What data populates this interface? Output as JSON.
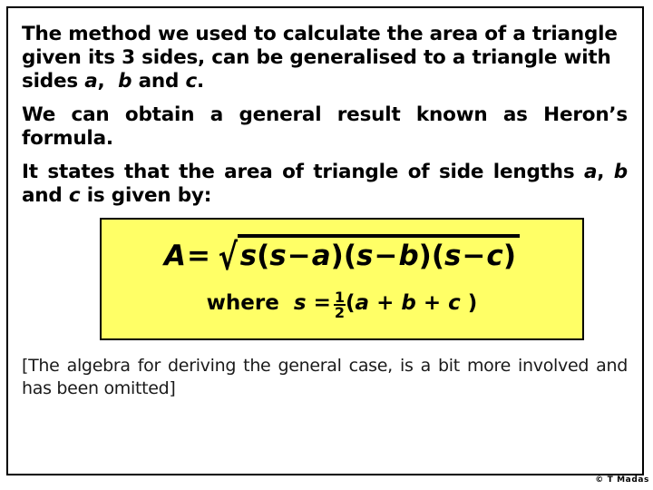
{
  "slide": {
    "paragraphs": [
      {
        "id": "intro",
        "segments": [
          {
            "text": "The method we used to calculate the area of a triangle given its 3 sides, can be generalised to a triangle with sides ",
            "style": "normal"
          },
          {
            "text": "a",
            "style": "italic"
          },
          {
            "text": ",  ",
            "style": "normal"
          },
          {
            "text": "b",
            "style": "italic"
          },
          {
            "text": " and ",
            "style": "normal"
          },
          {
            "text": "c",
            "style": "italic"
          },
          {
            "text": ".",
            "style": "normal"
          }
        ],
        "plain": "The method we used to calculate the area of a triangle given its 3 sides, can be generalised to a triangle with sides a,  b and c."
      },
      {
        "id": "heron",
        "plain": "We can obtain a general result known as Heron’s formula."
      },
      {
        "id": "states",
        "plain": "It states that the area of triangle of side lengths a, b and c is given by:"
      }
    ],
    "intro_line1": "The method we used to calculate the area of a triangle",
    "intro_line2": "given its 3 sides, can be generalised to a triangle with",
    "intro_line3_prefix": "sides ",
    "intro_var_a": "a",
    "intro_comma1": ",",
    "intro_var_b": "b",
    "intro_and": "and",
    "intro_var_c": "c",
    "intro_period": ".",
    "heron_text": "We can obtain a general result known as Heron’s formula.",
    "states_prefix": "It states that the area of triangle of side lengths ",
    "states_var_a": "a",
    "states_comma": ",",
    "states_var_b": "b",
    "states_and": "and",
    "states_var_c": "c",
    "states_suffix": " is given by:",
    "closing_note": "[The algebra for deriving the general case, is a bit more involved and has been omitted]",
    "copyright": "© T Madas"
  },
  "formula": {
    "box_color": "#ffff66",
    "border_color": "#000000",
    "main": {
      "lhs_var": "A",
      "equals": "=",
      "radical_sign": "√",
      "radicand_plain": "s(s−a)(s−b)(s−c)",
      "terms": [
        {
          "var": "s"
        },
        {
          "open": "(",
          "var1": "s",
          "op": "−",
          "var2": "a",
          "close": ")"
        },
        {
          "open": "(",
          "var1": "s",
          "op": "−",
          "var2": "b",
          "close": ")"
        },
        {
          "open": "(",
          "var1": "s",
          "op": "−",
          "var2": "c",
          "close": ")"
        }
      ],
      "s1": "s",
      "p1_open": "(",
      "p1_s": "s",
      "p1_minus": "−",
      "p1_var": "a",
      "p1_close": ")",
      "p2_open": "(",
      "p2_s": "s",
      "p2_minus": "−",
      "p2_var": "b",
      "p2_close": ")",
      "p3_open": "(",
      "p3_s": "s",
      "p3_minus": "−",
      "p3_var": "c",
      "p3_close": ")",
      "full_text": "A = √( s(s−a)(s−b)(s−c) )"
    },
    "where": {
      "keyword": "where",
      "subject": "s",
      "equals": "=",
      "numerator": "1",
      "denominator": "2",
      "open_paren": "(",
      "var_a": "a",
      "plus1": "+",
      "var_b": "b",
      "plus2": "+",
      "var_c": "c",
      "close_paren": ")",
      "full_text": "where s = 1/2(a + b + c )"
    }
  }
}
